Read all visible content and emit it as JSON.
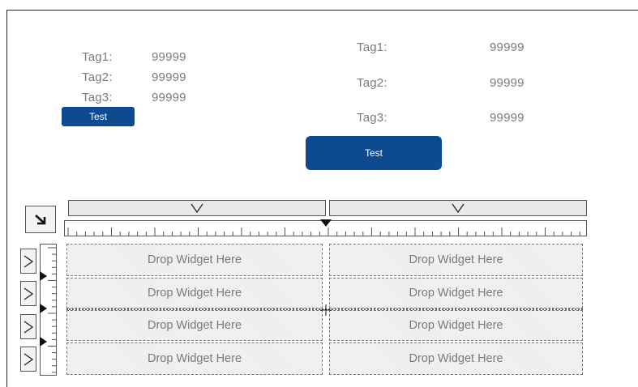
{
  "left_panel": {
    "rows": [
      {
        "tag": "Tag1:",
        "value": "99999"
      },
      {
        "tag": "Tag2:",
        "value": "99999"
      },
      {
        "tag": "Tag3:",
        "value": "99999"
      }
    ],
    "button_label": "Test"
  },
  "right_panel": {
    "rows": [
      {
        "tag": "Tag1:",
        "value": "99999"
      },
      {
        "tag": "Tag2:",
        "value": "99999"
      },
      {
        "tag": "Tag3:",
        "value": "99999"
      }
    ],
    "button_label": "Test"
  },
  "layout_editor": {
    "corner_icon": "arrow-down-right-icon",
    "column_collapse_icon": "chevron-down-icon",
    "row_expand_icon": "chevron-right-icon",
    "columns": 2,
    "rows": 4,
    "cells": [
      "Drop Widget Here",
      "Drop Widget Here",
      "Drop Widget Here",
      "Drop Widget Here",
      "Drop Widget Here",
      "Drop Widget Here",
      "Drop Widget Here",
      "Drop Widget Here"
    ]
  },
  "colors": {
    "accent": "#0d4a8f",
    "label": "#7b7b7b",
    "cell_background": "#ececec"
  }
}
